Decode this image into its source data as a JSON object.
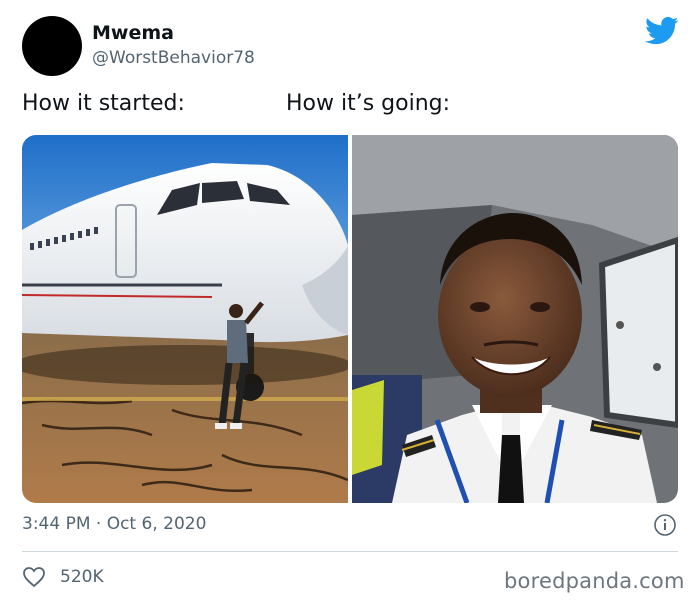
{
  "author": {
    "name": "Mwema",
    "handle": "@WorstBehavior78"
  },
  "captions": {
    "left": "How it started:",
    "right": "How it’s going:"
  },
  "icons": {
    "brand": "twitter-bird-icon",
    "info": "info-icon",
    "like": "heart-icon"
  },
  "timestamp": "3:44 PM · Oct 6, 2020",
  "likes_count": "520K",
  "watermark": "boredpanda.com",
  "colors": {
    "twitter_blue": "#1d9bf0",
    "secondary_text": "#536471",
    "divider": "#cfd9de"
  }
}
